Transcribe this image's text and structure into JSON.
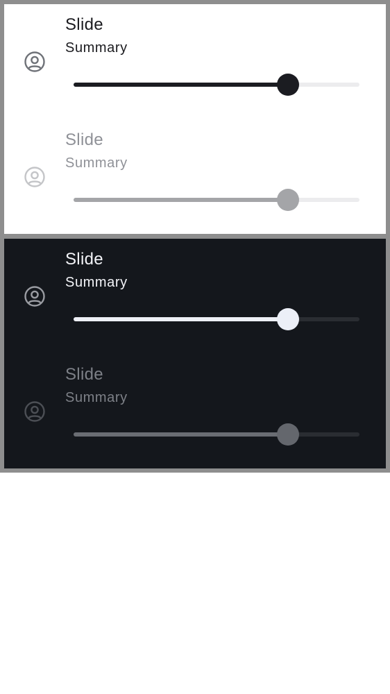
{
  "panels": {
    "light": {
      "items": [
        {
          "title": "Slide",
          "summary": "Summary",
          "value": 0.75,
          "enabled": true,
          "icon": "account-circle-icon"
        },
        {
          "title": "Slide",
          "summary": "Summary",
          "value": 0.75,
          "enabled": false,
          "icon": "account-circle-icon"
        }
      ]
    },
    "dark": {
      "items": [
        {
          "title": "Slide",
          "summary": "Summary",
          "value": 0.75,
          "enabled": true,
          "icon": "account-circle-icon"
        },
        {
          "title": "Slide",
          "summary": "Summary",
          "value": 0.75,
          "enabled": false,
          "icon": "account-circle-icon"
        }
      ]
    }
  }
}
